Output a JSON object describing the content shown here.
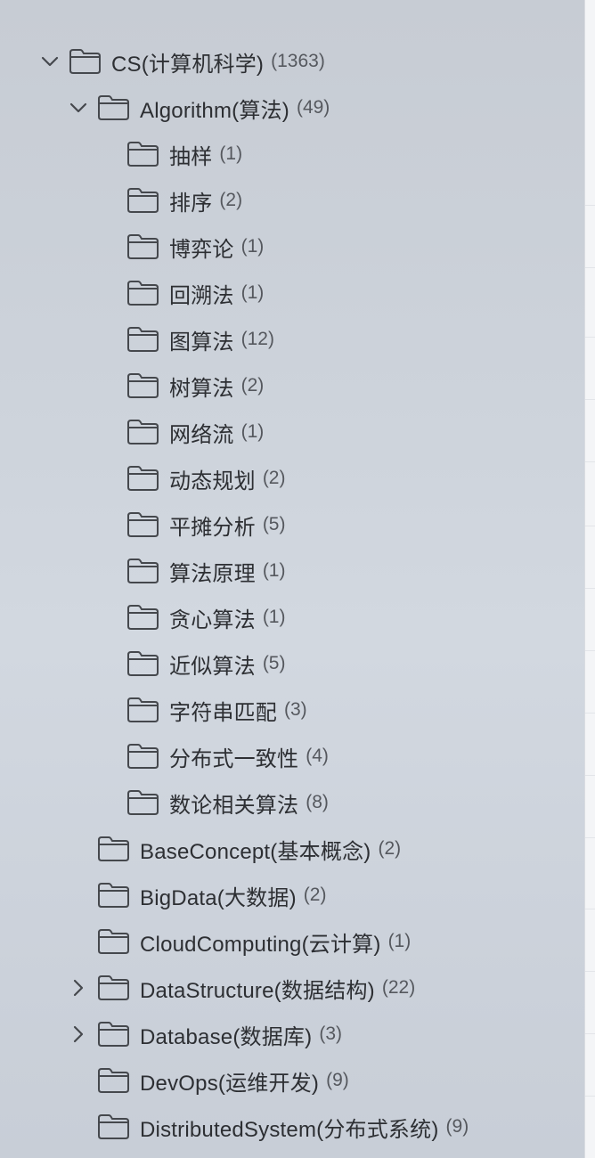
{
  "tree": {
    "root": {
      "label": "CS(计算机科学)",
      "count": "(1363)",
      "expanded": true,
      "children": [
        {
          "label": "Algorithm(算法)",
          "count": "(49)",
          "expanded": true,
          "children": [
            {
              "label": "抽样",
              "count": "(1)"
            },
            {
              "label": "排序",
              "count": "(2)"
            },
            {
              "label": "博弈论",
              "count": "(1)"
            },
            {
              "label": "回溯法",
              "count": "(1)"
            },
            {
              "label": "图算法",
              "count": "(12)"
            },
            {
              "label": "树算法",
              "count": "(2)"
            },
            {
              "label": "网络流",
              "count": "(1)"
            },
            {
              "label": "动态规划",
              "count": "(2)"
            },
            {
              "label": "平摊分析",
              "count": "(5)"
            },
            {
              "label": "算法原理",
              "count": "(1)"
            },
            {
              "label": "贪心算法",
              "count": "(1)"
            },
            {
              "label": "近似算法",
              "count": "(5)"
            },
            {
              "label": "字符串匹配",
              "count": "(3)"
            },
            {
              "label": "分布式一致性",
              "count": "(4)"
            },
            {
              "label": "数论相关算法",
              "count": "(8)"
            }
          ]
        },
        {
          "label": "BaseConcept(基本概念)",
          "count": "(2)"
        },
        {
          "label": "BigData(大数据)",
          "count": "(2)"
        },
        {
          "label": "CloudComputing(云计算)",
          "count": "(1)"
        },
        {
          "label": "DataStructure(数据结构)",
          "count": "(22)",
          "expanded": false,
          "has_children": true
        },
        {
          "label": "Database(数据库)",
          "count": "(3)",
          "expanded": false,
          "has_children": true
        },
        {
          "label": "DevOps(运维开发)",
          "count": "(9)"
        },
        {
          "label": "DistributedSystem(分布式系统)",
          "count": "(9)"
        }
      ]
    }
  },
  "icons": {
    "folder": "folder-icon",
    "expanded": "chevron-down-icon",
    "collapsed": "chevron-right-icon"
  },
  "colors": {
    "text": "#2d2f33",
    "count": "#55585e",
    "icon_stroke": "#45484d"
  }
}
